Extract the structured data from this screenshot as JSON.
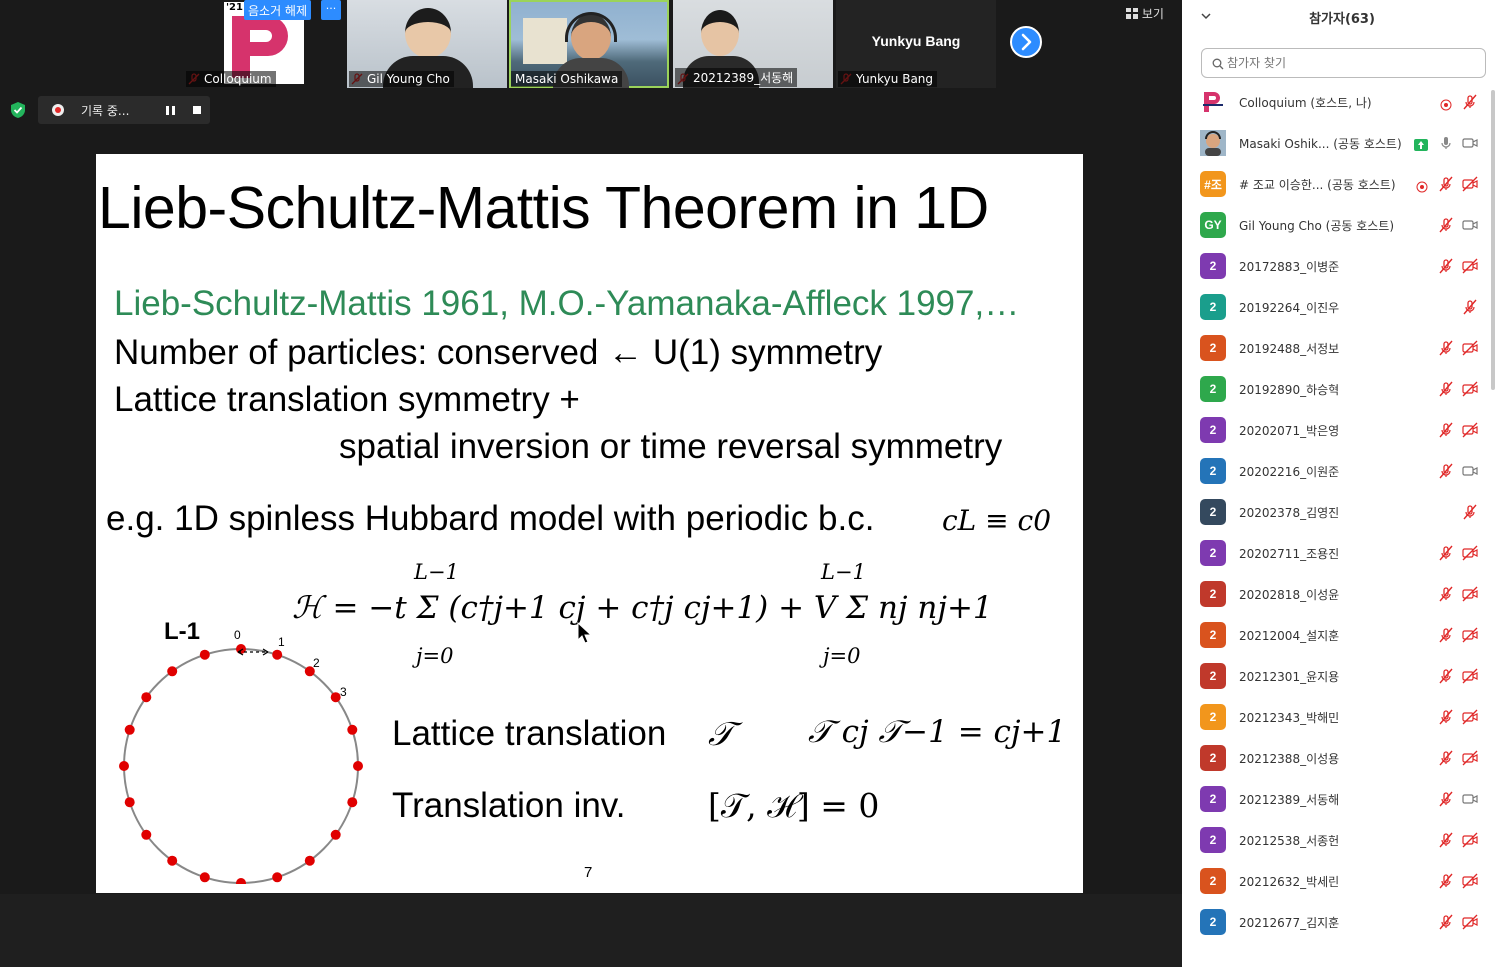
{
  "thumbs": [
    {
      "name": "Colloquium",
      "badge_21": "'21",
      "unmute_label": "음소거 해제",
      "more_label": "···"
    },
    {
      "name": "Gil Young Cho"
    },
    {
      "name": "Masaki Oshikawa"
    },
    {
      "name": "20212389_서동해"
    },
    {
      "name": "Yunkyu Bang",
      "center_name": "Yunkyu Bang"
    }
  ],
  "view_label": "보기",
  "recording": {
    "label": "기록 중..."
  },
  "slide": {
    "title": "Lieb-Schultz-Mattis Theorem in 1D",
    "refs": "Lieb-Schultz-Mattis 1961, M.O.-Yamanaka-Affleck 1997,…",
    "line1": "Number of particles: conserved ← U(1) symmetry",
    "line2": "Lattice translation symmetry +",
    "line3": "spatial inversion or time reversal symmetry",
    "eg": "e.g. 1D spinless Hubbard model with periodic b.c.",
    "bc": "cL ≡ c0",
    "hamiltonian": "ℋ = −t Σ (c†j+1 cj + c†j cj+1) + V Σ nj nj+1",
    "sum_upper": "L−1",
    "sum_lower": "j=0",
    "ring_label": "L-1",
    "site_labels": [
      "0",
      "1",
      "2",
      "3"
    ],
    "lt_label": "Lattice translation",
    "lt_symbol": "𝒯",
    "lt_eq": "𝒯 cj 𝒯−1 = cj+1",
    "ti_label": "Translation inv.",
    "ti_eq": "[𝒯, ℋ] = 0",
    "page": "7"
  },
  "panel": {
    "title": "참가자(63)",
    "search_placeholder": "참가자 찾기",
    "participants": [
      {
        "name": "Colloquium (호스트, 나)",
        "avatar": "P",
        "color": "#ffffff",
        "rec": true,
        "mic": "muted",
        "video": "none"
      },
      {
        "name": "Masaki Oshik... (공동 호스트)",
        "avatar": "M",
        "color": "#8a5a3c",
        "mic": "on",
        "video": "on",
        "share": true
      },
      {
        "name": "# 조교 이승한... (공동 호스트)",
        "avatar": "#조",
        "color": "#f2961c",
        "rec": true,
        "mic": "muted",
        "video": "off"
      },
      {
        "name": "Gil Young Cho (공동 호스트)",
        "avatar": "GY",
        "color": "#2ea84c",
        "mic": "muted",
        "video": "on"
      },
      {
        "name": "20172883_이병준",
        "avatar": "2",
        "color": "#7e3ab0",
        "mic": "muted",
        "video": "off"
      },
      {
        "name": "20192264_이진우",
        "avatar": "2",
        "color": "#1a9e8c",
        "mic": "muted",
        "video": "none"
      },
      {
        "name": "20192488_서정보",
        "avatar": "2",
        "color": "#d9531e",
        "mic": "muted",
        "video": "off"
      },
      {
        "name": "20192890_하승혁",
        "avatar": "2",
        "color": "#2ea84c",
        "mic": "muted",
        "video": "off"
      },
      {
        "name": "20202071_박은영",
        "avatar": "2",
        "color": "#7e3ab0",
        "mic": "muted",
        "video": "off"
      },
      {
        "name": "20202216_이원준",
        "avatar": "2",
        "color": "#2474b8",
        "mic": "muted",
        "video": "on"
      },
      {
        "name": "20202378_김영진",
        "avatar": "2",
        "color": "#34495e",
        "mic": "muted",
        "video": "none"
      },
      {
        "name": "20202711_조용진",
        "avatar": "2",
        "color": "#7e3ab0",
        "mic": "muted",
        "video": "off"
      },
      {
        "name": "20202818_이성윤",
        "avatar": "2",
        "color": "#c0392b",
        "mic": "muted",
        "video": "off"
      },
      {
        "name": "20212004_설지훈",
        "avatar": "2",
        "color": "#d9531e",
        "mic": "muted",
        "video": "off"
      },
      {
        "name": "20212301_윤지용",
        "avatar": "2",
        "color": "#c0392b",
        "mic": "muted",
        "video": "off"
      },
      {
        "name": "20212343_박해민",
        "avatar": "2",
        "color": "#f2961c",
        "mic": "muted",
        "video": "off"
      },
      {
        "name": "20212388_이성용",
        "avatar": "2",
        "color": "#c0392b",
        "mic": "muted",
        "video": "off"
      },
      {
        "name": "20212389_서동해",
        "avatar": "2",
        "color": "#7e3ab0",
        "mic": "muted",
        "video": "on"
      },
      {
        "name": "20212538_서종헌",
        "avatar": "2",
        "color": "#7e3ab0",
        "mic": "muted",
        "video": "off"
      },
      {
        "name": "20212632_박세린",
        "avatar": "2",
        "color": "#d9531e",
        "mic": "muted",
        "video": "off"
      },
      {
        "name": "20212677_김지훈",
        "avatar": "2",
        "color": "#2474b8",
        "mic": "muted",
        "video": "off"
      }
    ]
  }
}
